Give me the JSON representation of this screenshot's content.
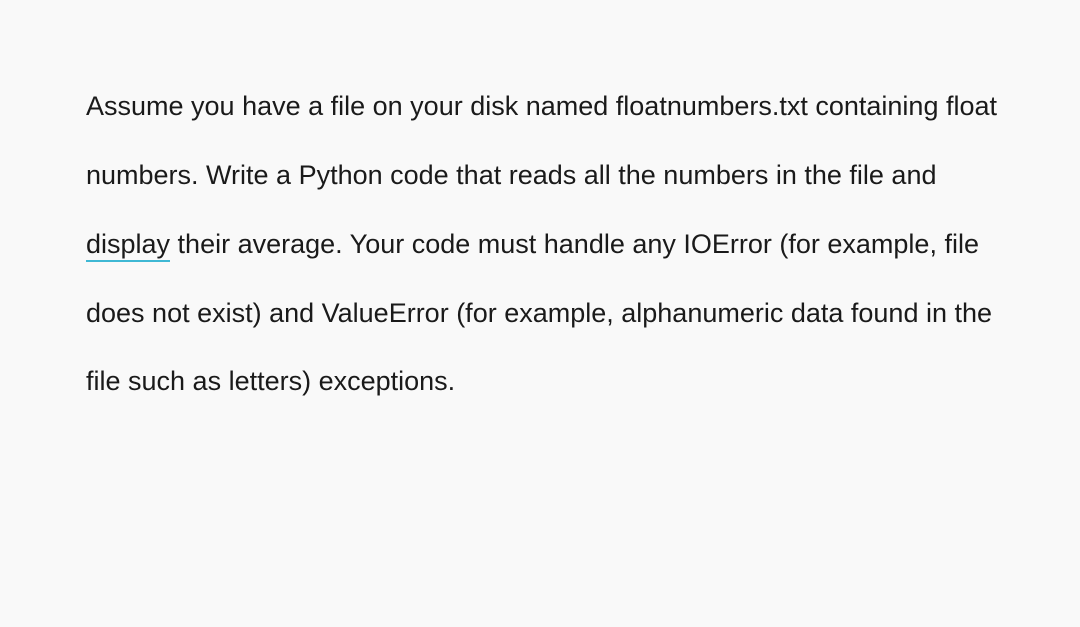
{
  "document": {
    "text_part1": "Assume you have a file on your disk named floatnumbers.txt  containing float numbers. Write a Python code that reads all the numbers in the file and ",
    "underlined_word": "display",
    "text_part2": " their average. Your code must handle any IOError (for example, file does not exist) and ValueError (for example, alphanumeric data found in the file such as letters) exceptions."
  }
}
